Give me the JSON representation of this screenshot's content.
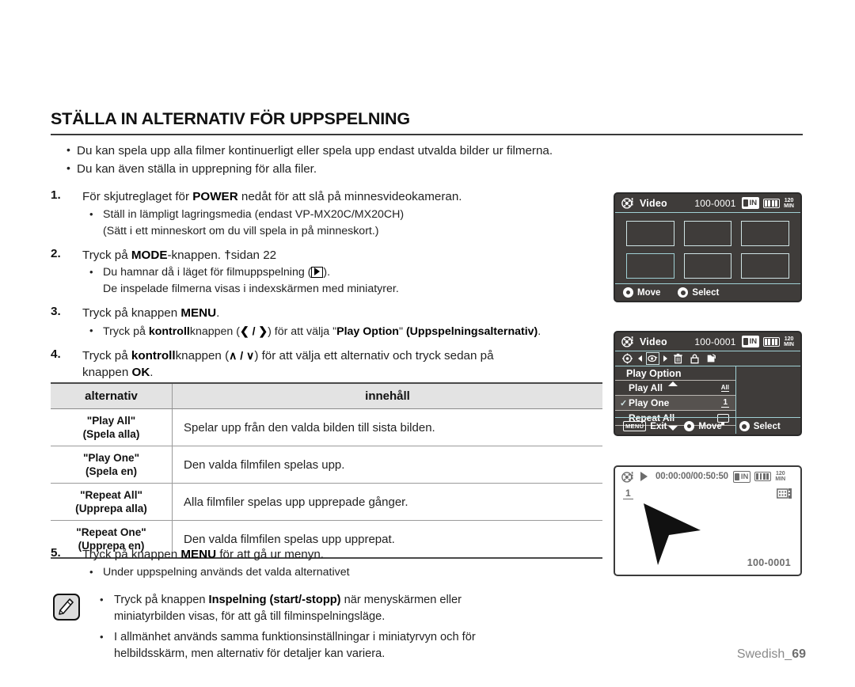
{
  "page": {
    "title": "STÄLLA IN ALTERNATIV FÖR UPPSPELNING",
    "footer_lang": "Swedish_",
    "footer_page": "69"
  },
  "intro_bullets": [
    "Du kan spela upp alla filmer kontinuerligt eller spela upp endast utvalda bilder ur filmerna.",
    "Du kan även ställa in upprepning för alla filer."
  ],
  "steps": {
    "s1": {
      "num": "1.",
      "text_a": "För skjutreglaget för ",
      "bold_a": "POWER",
      "text_b": " nedåt för att slå på minnesvideokameran.",
      "bullet": "Ställ in lämpligt lagringsmedia (endast VP-MX20C/MX20CH)",
      "bullet_cont": "(Sätt i ett minneskort om du vill spela in på minneskort.)"
    },
    "s2": {
      "num": "2.",
      "text_a": "Tryck på ",
      "bold_a": "MODE",
      "text_b": "-knappen. ",
      "ref": "sidan 22",
      "bullet_a": "Du hamnar då i läget för filmuppspelning (",
      "bullet_b": ").",
      "bullet_cont": "De inspelade filmerna visas i indexskärmen med miniatyrer."
    },
    "s3": {
      "num": "3.",
      "text_a": "Tryck på knappen ",
      "bold_a": "MENU",
      "text_b": ".",
      "bullet_a": "Tryck på ",
      "bullet_bold": "kontroll",
      "bullet_b": "knappen (",
      "arrows": "❮ / ❯",
      "bullet_c": ") för att välja \"",
      "bullet_bold2": "Play Option",
      "bullet_d": "\" ",
      "bullet_bold3": "(Uppspelningsalternativ)",
      "bullet_e": "."
    },
    "s4": {
      "num": "4.",
      "text_a": "Tryck på ",
      "bold_a": "kontroll",
      "text_b": "knappen (",
      "arrows": "∧ / ∨",
      "text_c": ") för att välja ett alternativ och tryck sedan på",
      "cont_a": "knappen ",
      "cont_bold": "OK",
      "cont_b": "."
    },
    "s5": {
      "num": "5.",
      "text_a": "Tryck på knappen ",
      "bold_a": "MENU",
      "text_b": " för att gå ur menyn.",
      "bullet": "Under uppspelning används det valda alternativet"
    }
  },
  "table": {
    "headers": [
      "alternativ",
      "innehåll"
    ],
    "rows": [
      {
        "option_en": "\"Play All\"",
        "option_sv": "(Spela alla)",
        "content": "Spelar upp från den valda bilden till sista bilden."
      },
      {
        "option_en": "\"Play One\"",
        "option_sv": "(Spela en)",
        "content": "Den valda filmfilen spelas upp."
      },
      {
        "option_en": "\"Repeat All\"",
        "option_sv": "(Upprepa alla)",
        "content": "Alla filmfiler spelas upp upprepade gånger."
      },
      {
        "option_en": "\"Repeat One\"",
        "option_sv": "(Upprepa en)",
        "content": "Den valda filmfilen spelas upp upprepat."
      }
    ]
  },
  "note": {
    "b1_a": "Tryck på knappen ",
    "b1_bold": "Inspelning (start/-stopp)",
    "b1_b": " när menyskärmen eller",
    "b1_cont": "miniatyrbilden visas, för att gå till filminspelningsläge.",
    "b2_a": "I allmänhet används samma funktionsinställningar i miniatyrvyn och för",
    "b2_cont": "helbildsskärm, men alternativ för detaljer kan variera."
  },
  "lcd1": {
    "title": "Video",
    "file_no": "100-0001",
    "storage_badge": "IN",
    "minutes_top": "120",
    "minutes_bottom": "MIN",
    "hint_move": "Move",
    "hint_select": "Select",
    "thumb_count": 6,
    "selected_thumb_index": 3
  },
  "lcd2": {
    "title": "Video",
    "file_no": "100-0001",
    "storage_badge": "IN",
    "minutes_top": "120",
    "minutes_bottom": "MIN",
    "menu_head": "Play Option",
    "items": [
      {
        "label": "Play All",
        "value_type": "all",
        "value_text": "All",
        "checked": false
      },
      {
        "label": "Play One",
        "value_type": "one",
        "value_text": "1",
        "checked": true
      },
      {
        "label": "Repeat All",
        "value_type": "loop",
        "value_text": "",
        "checked": false
      }
    ],
    "hint_exit_chip": "MENU",
    "hint_exit": "Exit",
    "hint_move": "Move",
    "hint_select": "Select"
  },
  "lcd3": {
    "timecode": "00:00:00/00:50:50",
    "storage_badge": "IN",
    "minutes_top": "120",
    "minutes_bottom": "MIN",
    "file_tag": "1",
    "file_no": "100-0001"
  },
  "colors": {
    "lcd_bg": "#3f3c3a",
    "lcd_accent": "#9fd0d4",
    "table_header_bg": "#e3e3e3",
    "footer_text": "#8a8a8a"
  }
}
